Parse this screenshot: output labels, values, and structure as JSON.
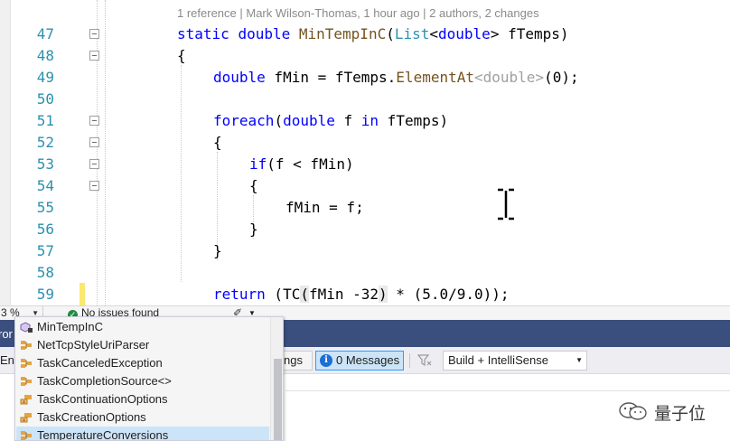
{
  "editor": {
    "codelens": "1 reference | Mark Wilson-Thomas, 1 hour ago | 2 authors, 2 changes",
    "lines": [
      {
        "num": "47",
        "tokens": [
          {
            "t": "static",
            "c": "kw"
          },
          {
            "t": " ",
            "c": "pl"
          },
          {
            "t": "double",
            "c": "kw"
          },
          {
            "t": " ",
            "c": "pl"
          },
          {
            "t": "MinTempInC",
            "c": "mt"
          },
          {
            "t": "(",
            "c": "pl"
          },
          {
            "t": "List",
            "c": "ty"
          },
          {
            "t": "<",
            "c": "pl"
          },
          {
            "t": "double",
            "c": "kw"
          },
          {
            "t": "> fTemps)",
            "c": "pl"
          }
        ]
      },
      {
        "num": "48",
        "tokens": [
          {
            "t": "{",
            "c": "pl"
          }
        ]
      },
      {
        "num": "49",
        "tokens": [
          {
            "t": "double",
            "c": "kw"
          },
          {
            "t": " fMin = fTemps.",
            "c": "pl"
          },
          {
            "t": "ElementAt",
            "c": "mt"
          },
          {
            "t": "<double>",
            "c": "ph"
          },
          {
            "t": "(0);",
            "c": "pl"
          }
        ]
      },
      {
        "num": "50",
        "tokens": []
      },
      {
        "num": "51",
        "tokens": [
          {
            "t": "foreach",
            "c": "kw"
          },
          {
            "t": "(",
            "c": "pl"
          },
          {
            "t": "double",
            "c": "kw"
          },
          {
            "t": " f ",
            "c": "pl"
          },
          {
            "t": "in",
            "c": "kw"
          },
          {
            "t": " fTemps)",
            "c": "pl"
          }
        ]
      },
      {
        "num": "52",
        "tokens": [
          {
            "t": "{",
            "c": "pl"
          }
        ]
      },
      {
        "num": "53",
        "tokens": [
          {
            "t": "if",
            "c": "kw"
          },
          {
            "t": "(f < fMin)",
            "c": "pl"
          }
        ]
      },
      {
        "num": "54",
        "tokens": [
          {
            "t": "{",
            "c": "pl"
          }
        ]
      },
      {
        "num": "55",
        "tokens": [
          {
            "t": "fMin = f;",
            "c": "pl"
          }
        ]
      },
      {
        "num": "56",
        "tokens": [
          {
            "t": "}",
            "c": "pl"
          }
        ]
      },
      {
        "num": "57",
        "tokens": [
          {
            "t": "}",
            "c": "pl"
          }
        ]
      },
      {
        "num": "58",
        "tokens": []
      },
      {
        "num": "59",
        "tokens": [
          {
            "t": "return",
            "c": "kw"
          },
          {
            "t": " (TC",
            "c": "pl"
          },
          {
            "t": "(",
            "c": "pl hl"
          },
          {
            "t": "fMin -32",
            "c": "pl"
          },
          {
            "t": ")",
            "c": "pl hl"
          },
          {
            "t": " * (5.0/9.0));",
            "c": "pl"
          }
        ]
      }
    ]
  },
  "status": {
    "zoom": "3 %",
    "issues": "No issues found"
  },
  "completion": {
    "items": [
      {
        "label": "MinTempInC",
        "icon": "method-icon"
      },
      {
        "label": "NetTcpStyleUriParser",
        "icon": "class-icon"
      },
      {
        "label": "TaskCanceledException",
        "icon": "class-icon"
      },
      {
        "label": "TaskCompletionSource<>",
        "icon": "class-icon"
      },
      {
        "label": "TaskContinuationOptions",
        "icon": "enum-icon"
      },
      {
        "label": "TaskCreationOptions",
        "icon": "enum-icon"
      },
      {
        "label": "TemperatureConversions",
        "icon": "class-icon",
        "selected": true
      }
    ]
  },
  "error_list": {
    "title": "ror",
    "scope_cut": "Enti",
    "warnings_cut": "ngs",
    "messages": "0 Messages",
    "source": "Build + IntelliSense"
  },
  "watermark": "量子位",
  "colors": {
    "keyword": "#0000ff",
    "type": "#2b91af",
    "method": "#74531f",
    "panel_title": "#3b4f7e",
    "selection": "#cce4f7",
    "change_bar": "#fbe86f"
  }
}
